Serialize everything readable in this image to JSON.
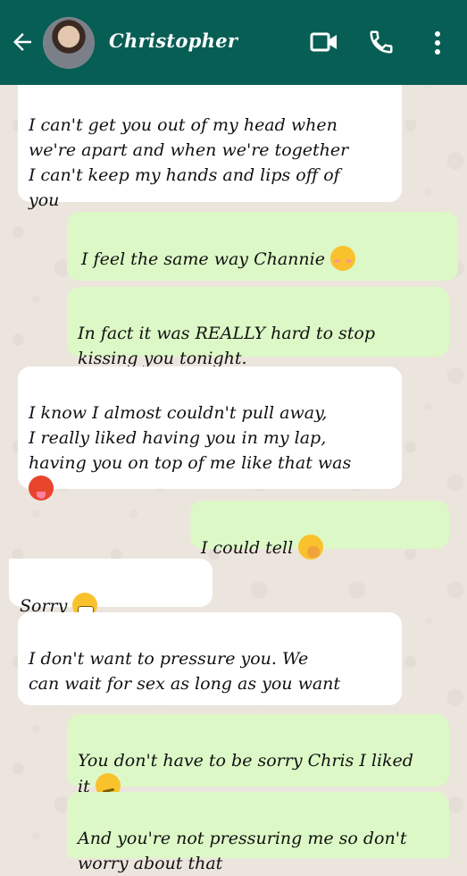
{
  "header": {
    "contact_name": "Christopher",
    "header_color": "#075e54",
    "icons": [
      "back-arrow-icon",
      "video-call-icon",
      "voice-call-icon",
      "more-vert-icon"
    ]
  },
  "messages": [
    {
      "direction": "in",
      "text": "I can't get you out of my head when\nwe're apart and when we're together\nI can't keep my hands and lips off of\nyou"
    },
    {
      "direction": "out",
      "text": "I feel the same way Channie",
      "emoji": "smiling-face-icon"
    },
    {
      "direction": "out",
      "text": "In fact it was REALLY hard to stop\nkissing you tonight."
    },
    {
      "direction": "in",
      "text": "I know I almost couldn't pull away,\nI really liked having you in my lap,\nhaving you on top of me like that was",
      "emoji": "hot-face-icon"
    },
    {
      "direction": "out",
      "text": "I could tell",
      "emoji": "hand-over-mouth-icon"
    },
    {
      "direction": "in",
      "text": "Sorry",
      "emoji": "grimacing-face-icon"
    },
    {
      "direction": "in",
      "text": "I don't want to pressure you. We\ncan wait for sex as long as you want"
    },
    {
      "direction": "out",
      "text": "You don't have to be sorry Chris I liked\nit",
      "emoji": "smirking-face-icon"
    },
    {
      "direction": "out",
      "text": "And you're not pressuring me so don't\nworry about that"
    }
  ],
  "colors": {
    "incoming": "#ffffff",
    "outgoing": "#dcf8c6",
    "wallpaper": "#ece5dd"
  }
}
